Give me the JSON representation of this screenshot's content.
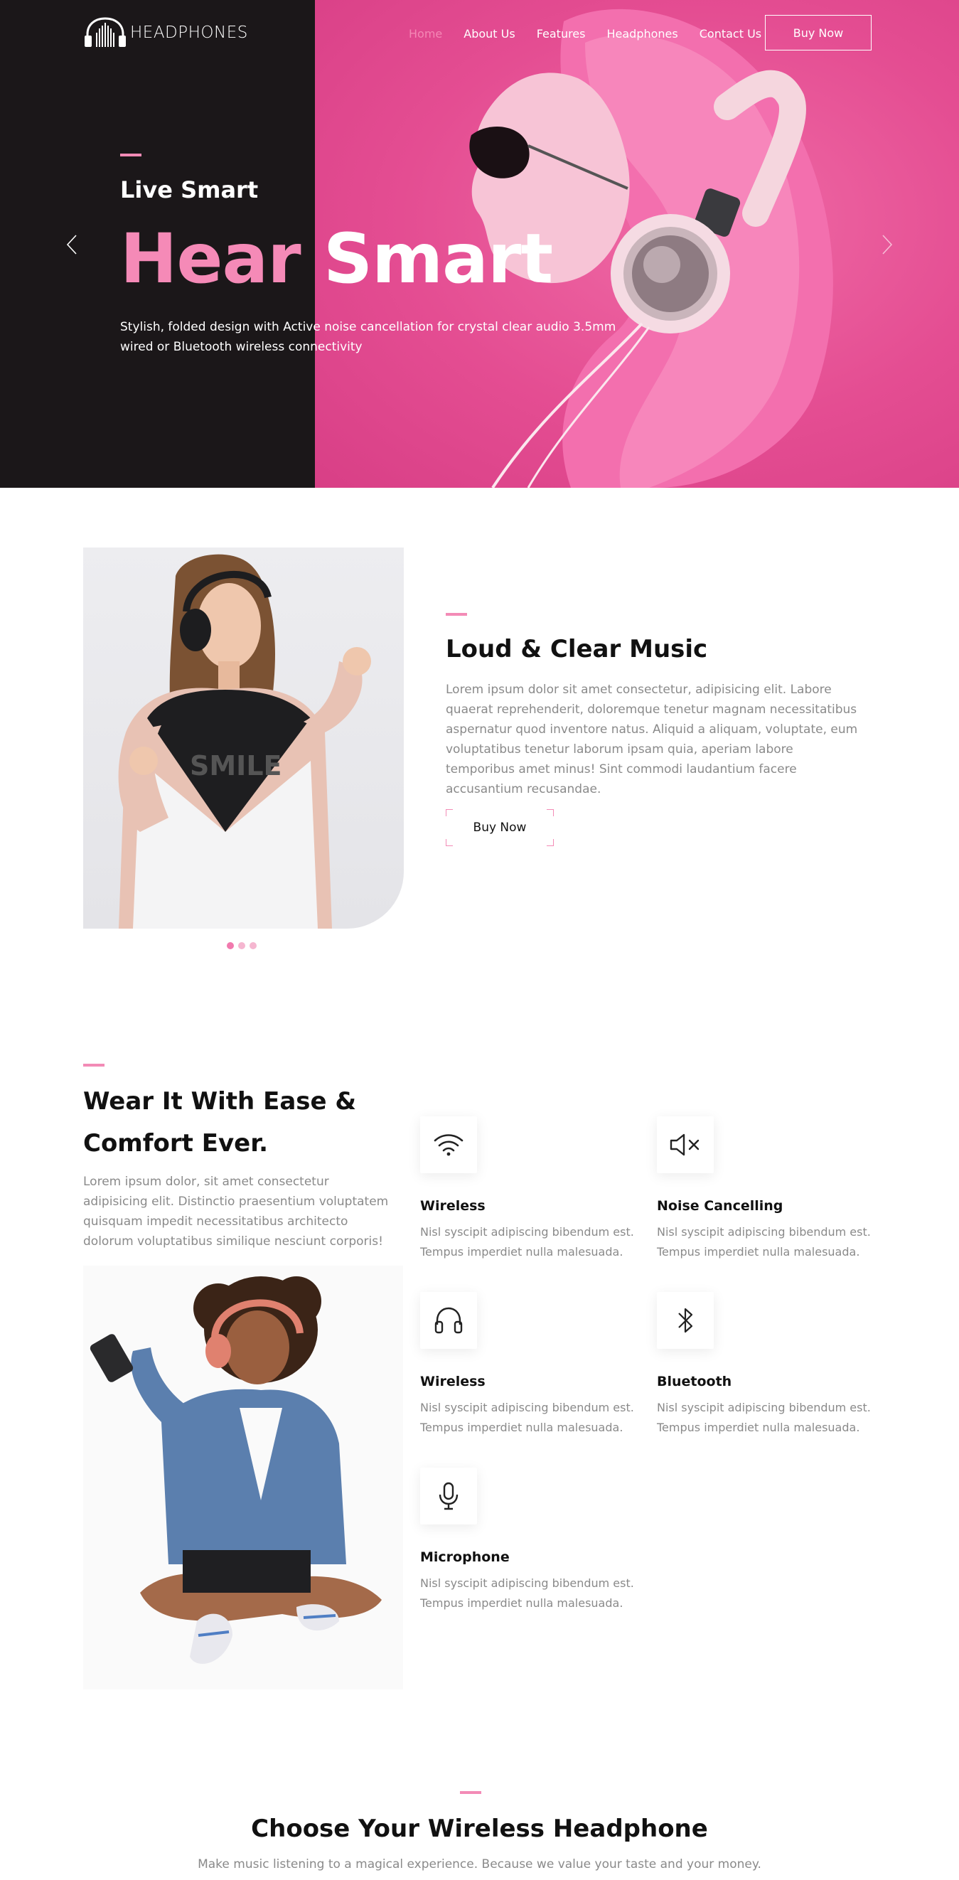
{
  "brand": {
    "logo_text": "HEADPHONES",
    "accent_color": "#f38bb6",
    "dark_color": "#1b1719",
    "hero_pink": "#e64d93"
  },
  "nav": {
    "items": [
      {
        "label": "Home",
        "active": true
      },
      {
        "label": "About Us"
      },
      {
        "label": "Features"
      },
      {
        "label": "Headphones"
      },
      {
        "label": "Contact Us"
      }
    ],
    "cta": "Buy Now"
  },
  "hero": {
    "subtitle": "Live Smart",
    "title_pink": "Hear",
    "title_white": "Smart",
    "description": "Stylish, folded design with Active noise cancellation for crystal clear audio 3.5mm wired or Bluetooth wireless connectivity",
    "prev_icon": "chevron-left-icon",
    "next_icon": "chevron-right-icon"
  },
  "music": {
    "title": "Loud & Clear Music",
    "text": "Lorem ipsum dolor sit amet consectetur, adipisicing elit. Labore quaerat reprehenderit, doloremque tenetur magnam necessitatibus aspernatur quod inventore natus. Aliquid a aliquam, voluptate, eum voluptatibus tenetur laborum ipsam quia, aperiam labore temporibus amet minus! Sint commodi laudantium facere accusantium recusandae.",
    "button": "Buy Now",
    "shirt_text": "SMILE"
  },
  "features": {
    "title": "Wear It With Ease & Comfort Ever.",
    "text": "Lorem ipsum dolor, sit amet consectetur adipisicing elit. Distinctio praesentium voluptatem quisquam impedit necessitatibus architecto dolorum voluptatibus similique nesciunt corporis!",
    "items": [
      {
        "icon": "wifi-icon",
        "title": "Wireless",
        "line1": "Nisl syscipit adipiscing bibendum est.",
        "line2": "Tempus imperdiet nulla malesuada."
      },
      {
        "icon": "speaker-mute-icon",
        "title": "Noise Cancelling",
        "line1": "Nisl syscipit adipiscing bibendum est.",
        "line2": "Tempus imperdiet nulla malesuada."
      },
      {
        "icon": "headphones-icon",
        "title": "Wireless",
        "line1": "Nisl syscipit adipiscing bibendum est.",
        "line2": "Tempus imperdiet nulla malesuada."
      },
      {
        "icon": "bluetooth-icon",
        "title": "Bluetooth",
        "line1": "Nisl syscipit adipiscing bibendum est.",
        "line2": "Tempus imperdiet nulla malesuada."
      },
      {
        "icon": "microphone-icon",
        "title": "Microphone",
        "line1": "Nisl syscipit adipiscing bibendum est.",
        "line2": "Tempus imperdiet nulla malesuada."
      }
    ]
  },
  "choose": {
    "title": "Choose Your Wireless Headphone",
    "subtitle": "Make music listening to a magical experience. Because we value your taste and your money."
  }
}
